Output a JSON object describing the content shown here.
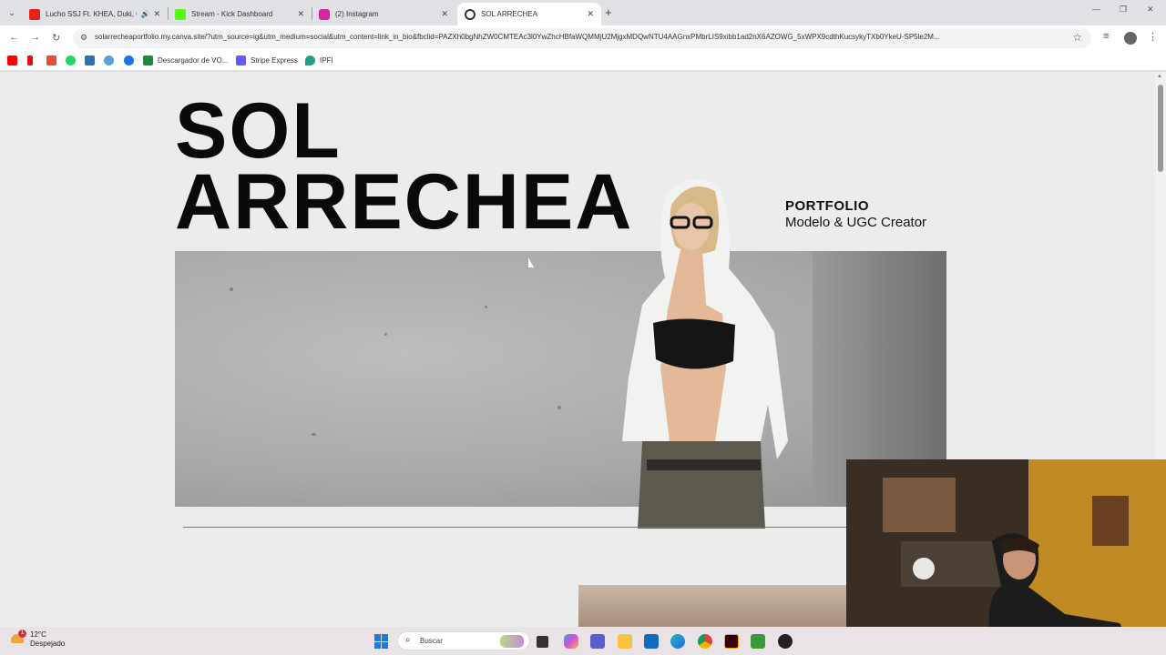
{
  "browser": {
    "tabs": [
      {
        "label": "Lucho SSJ Ft. KHEA, Duki, C",
        "color": "#e62117"
      },
      {
        "label": "Stream - Kick Dashboard",
        "color": "#53fc18"
      },
      {
        "label": "(2) Instagram",
        "color": "#d6249f"
      },
      {
        "label": "SOL ARRECHEA",
        "color": "#444444"
      }
    ],
    "url": "solarrecheaportfolio.my.canva.site/?utm_source=ig&utm_medium=social&utm_content=link_in_bio&fbclid=PAZXh0bgNhZW0CMTEAc3l0YwZhcHBfaWQMMjU2MjgxMDQwNTU4AAGnxPMbrLIS9xibb1ad2nX6AZOWG_5xWPX9cdthKucsykyTXb0YkeU-SP5le2M..."
  },
  "bookmarks": [
    {
      "label": "",
      "color": "#ff0000"
    },
    {
      "label": "",
      "color": "#e50914"
    },
    {
      "label": "",
      "color": "#e84b3c"
    },
    {
      "label": "",
      "color": "#25d366"
    },
    {
      "label": "",
      "color": "#2f6fb5"
    },
    {
      "label": "",
      "color": "#5aa0d8"
    },
    {
      "label": "",
      "color": "#1a73e8"
    },
    {
      "label": "Descargador de VO...",
      "color": "#1d8a3b"
    },
    {
      "label": "Stripe Express",
      "color": "#635bff"
    },
    {
      "label": "IPFI",
      "color": "#21a089"
    }
  ],
  "page": {
    "title_line1": "SOL",
    "title_line2": "ARRECHEA",
    "portfolio_heading": "PORTFOLIO",
    "portfolio_subtitle": "Modelo & UGC Creator"
  },
  "taskbar": {
    "weather_temp": "12°C",
    "weather_desc": "Despejado",
    "badge": "1",
    "search_placeholder": "Buscar"
  }
}
